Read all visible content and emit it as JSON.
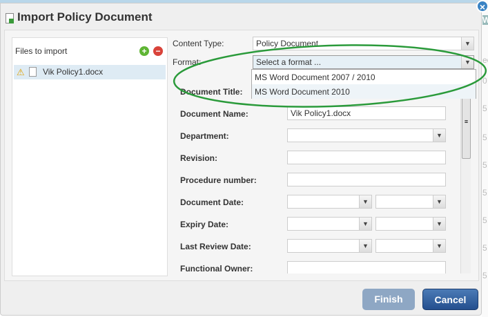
{
  "dialog": {
    "title": "Import Policy Document",
    "finish_label": "Finish",
    "cancel_label": "Cancel"
  },
  "files": {
    "header": "Files to import",
    "items": [
      {
        "name": "Vik Policy1.docx",
        "status": "warning"
      }
    ]
  },
  "form": {
    "content_type": {
      "label": "Content Type:",
      "value": "Policy Document"
    },
    "format": {
      "label": "Format:",
      "value": "Select a format ...",
      "options": [
        "MS Word Document 2007 / 2010",
        "MS Word Document 2010"
      ]
    },
    "document_title": {
      "label": "Document Title:"
    },
    "document_name": {
      "label": "Document Name:",
      "value": "Vik Policy1.docx"
    },
    "department": {
      "label": "Department:"
    },
    "revision": {
      "label": "Revision:"
    },
    "procedure_number": {
      "label": "Procedure number:"
    },
    "document_date": {
      "label": "Document Date:"
    },
    "expiry_date": {
      "label": "Expiry Date:"
    },
    "last_review_date": {
      "label": "Last Review Date:"
    },
    "functional_owner": {
      "label": "Functional Owner:"
    }
  },
  "annotation_color": "#2a9a3a",
  "background_fragments": [
    "W",
    "ec",
    "0",
    "5",
    "5",
    "5",
    "5",
    "5",
    "5",
    "5"
  ]
}
